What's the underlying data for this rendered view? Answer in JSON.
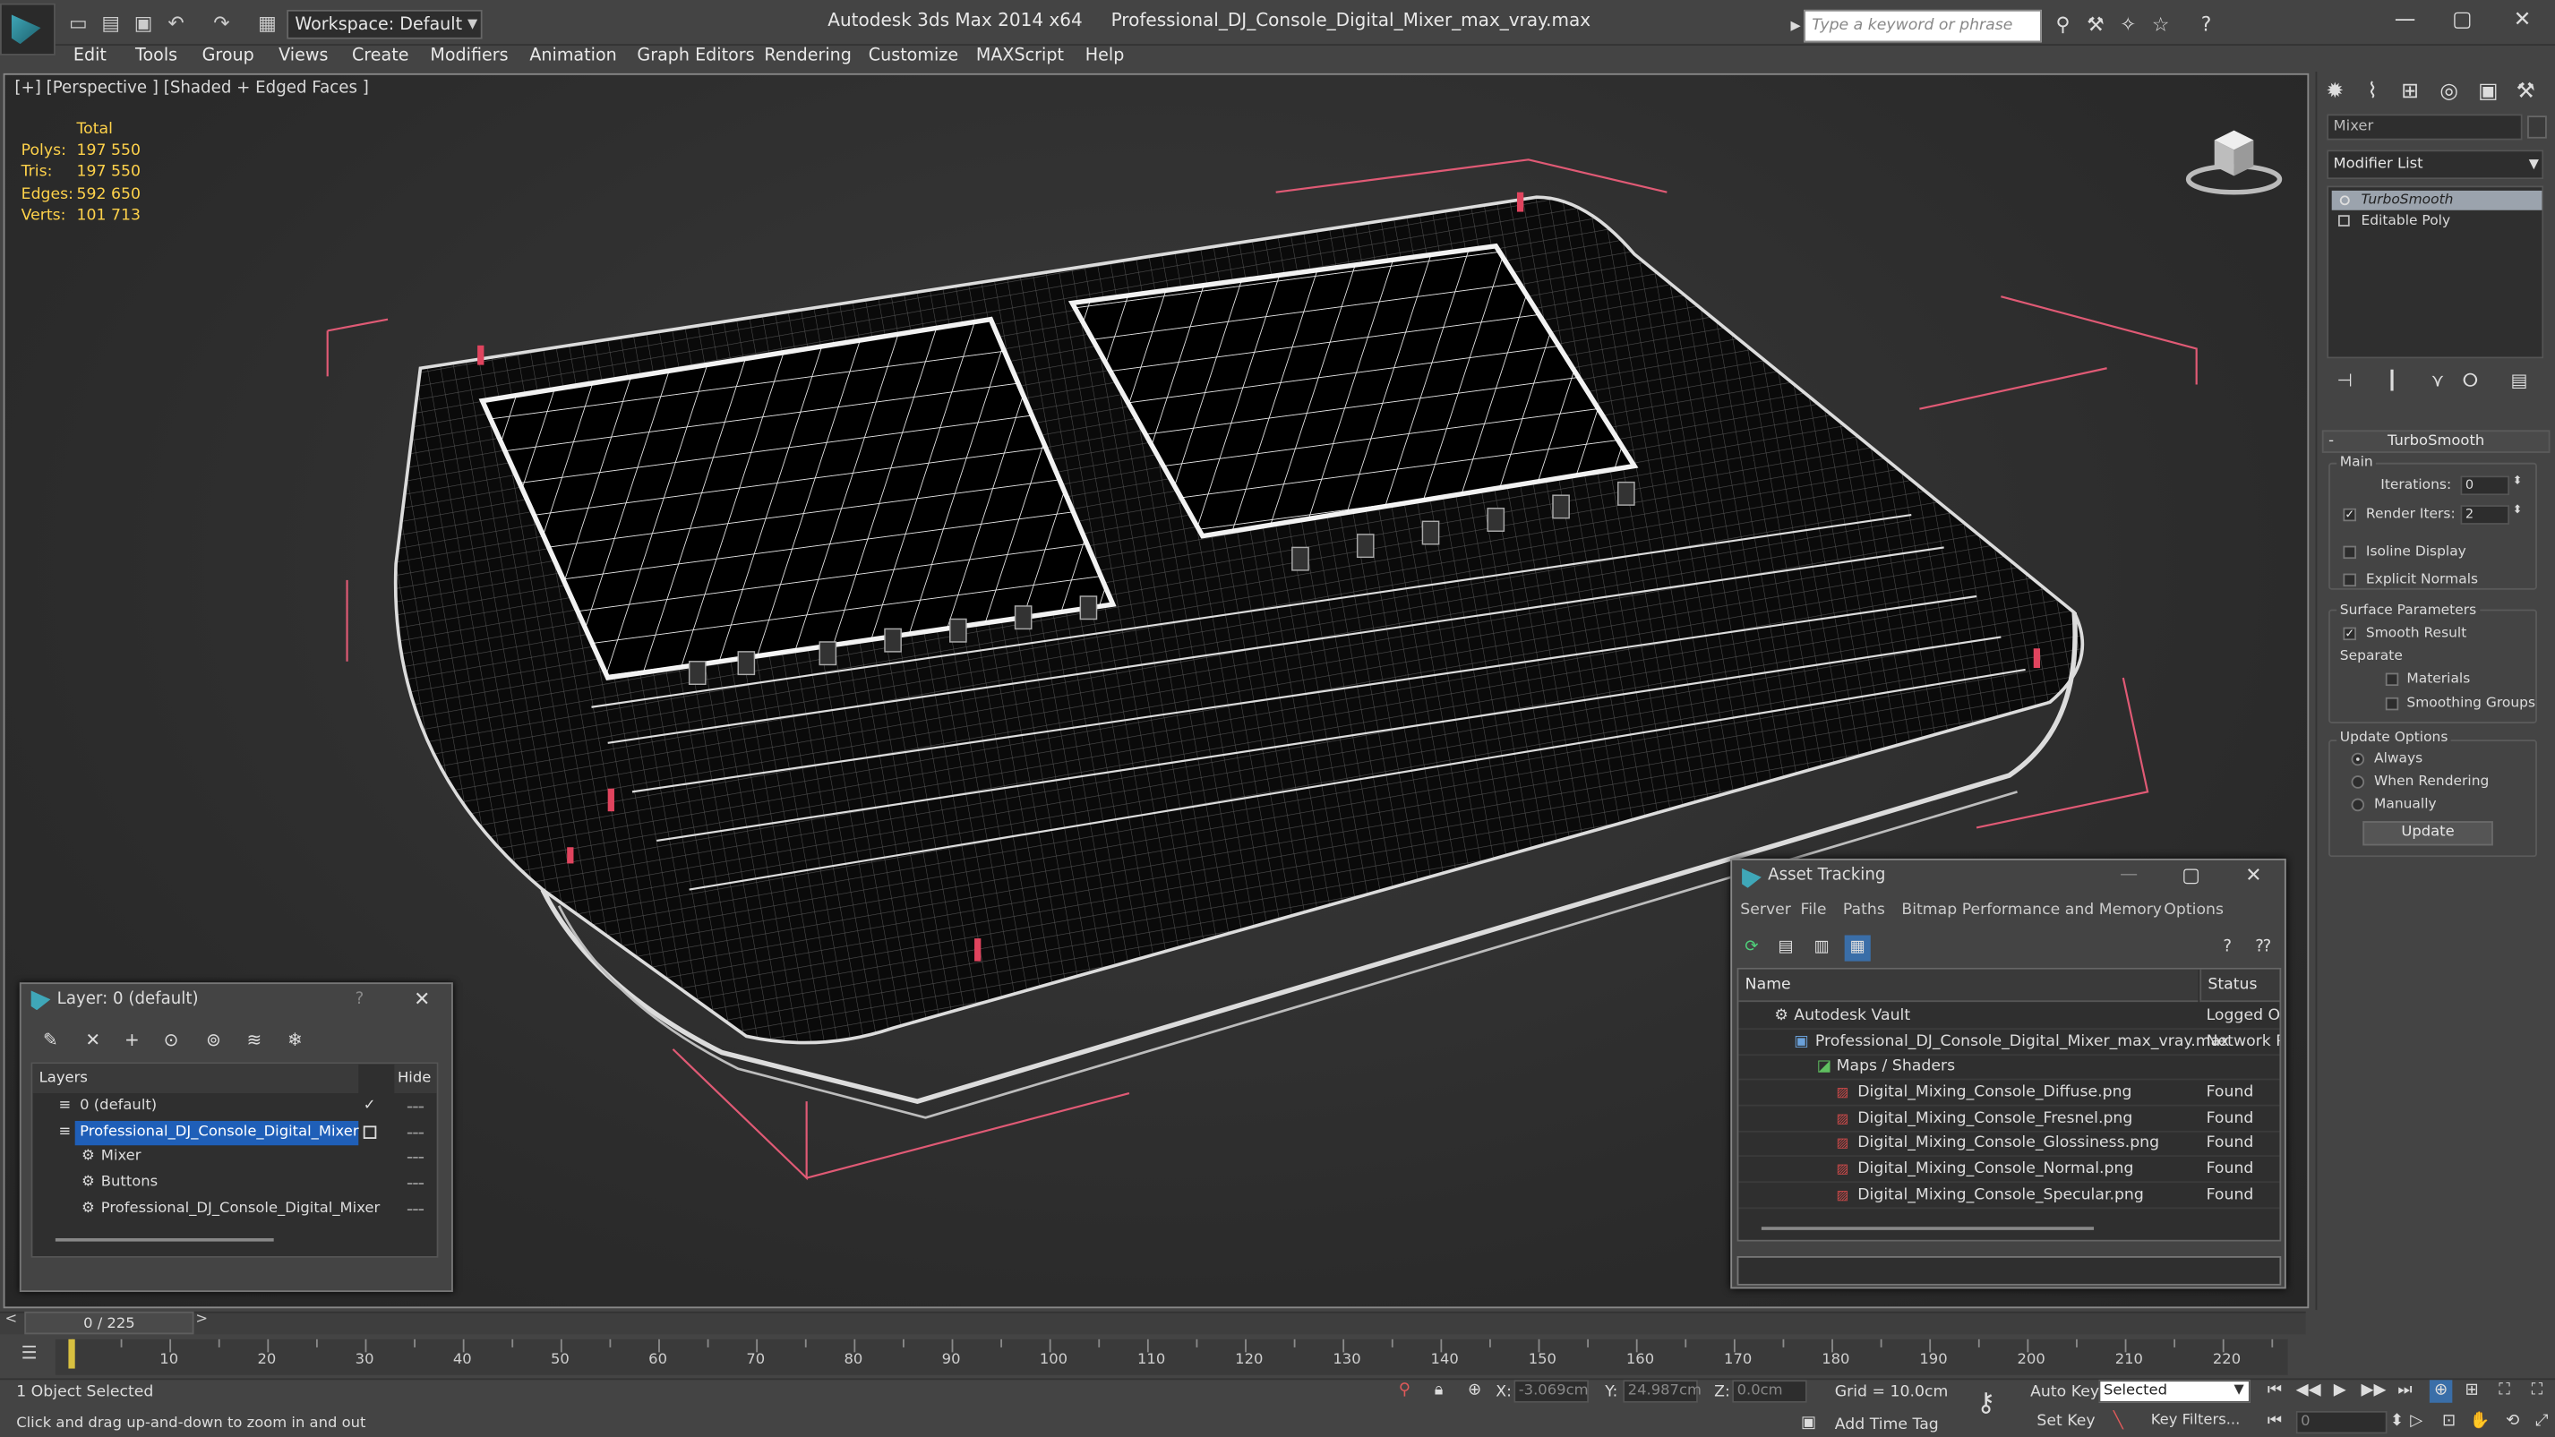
{
  "titlebar": {
    "workspace": "Workspace: Default",
    "app_name": "Autodesk 3ds Max  2014 x64",
    "file_name": "Professional_DJ_Console_Digital_Mixer_max_vray.max",
    "search_placeholder": "Type a keyword or phrase"
  },
  "menu": [
    "Edit",
    "Tools",
    "Group",
    "Views",
    "Create",
    "Modifiers",
    "Animation",
    "Graph Editors",
    "Rendering",
    "Customize",
    "MAXScript",
    "Help"
  ],
  "viewport": {
    "label": "[+] [Perspective ] [Shaded + Edged Faces ]",
    "stats": {
      "header": "Total",
      "rows": [
        {
          "label": "Polys:",
          "value": "197 550"
        },
        {
          "label": "Tris:",
          "value": "197 550"
        },
        {
          "label": "Edges:",
          "value": "592 650"
        },
        {
          "label": "Verts:",
          "value": "101 713"
        }
      ]
    }
  },
  "command_panel": {
    "object_name": "Mixer",
    "modifier_list": "Modifier List",
    "stack": [
      {
        "label": "TurboSmooth",
        "selected": true
      },
      {
        "label": "Editable Poly",
        "selected": false
      }
    ],
    "rollout_title": "TurboSmooth",
    "main_label": "Main",
    "iterations_label": "Iterations:",
    "iterations_value": "0",
    "render_iters_label": "Render Iters:",
    "render_iters_value": "2",
    "isoline_label": "Isoline Display",
    "explicit_label": "Explicit Normals",
    "surface_label": "Surface Parameters",
    "smooth_label": "Smooth Result",
    "separate_label": "Separate",
    "materials_label": "Materials",
    "smoothing_groups_label": "Smoothing Groups",
    "update_options_label": "Update Options",
    "always_label": "Always",
    "when_rendering_label": "When Rendering",
    "manually_label": "Manually",
    "update_button": "Update"
  },
  "layer_window": {
    "title": "Layer: 0 (default)",
    "help": "?",
    "col_layers": "Layers",
    "col_hide": "Hide",
    "rows": [
      {
        "name": "0 (default)",
        "indent": 1,
        "selected": false
      },
      {
        "name": "Professional_DJ_Console_Digital_Mixer",
        "indent": 1,
        "selected": true
      },
      {
        "name": "Mixer",
        "indent": 2,
        "selected": false
      },
      {
        "name": "Buttons",
        "indent": 2,
        "selected": false
      },
      {
        "name": "Professional_DJ_Console_Digital_Mixer",
        "indent": 2,
        "selected": false
      }
    ]
  },
  "asset_window": {
    "title": "Asset Tracking",
    "menu": [
      "Server",
      "File",
      "Paths",
      "Bitmap Performance and Memory",
      "Options"
    ],
    "col_name": "Name",
    "col_status": "Status",
    "rows": [
      {
        "name": "Autodesk Vault",
        "status": "Logged Ou",
        "indent": 1
      },
      {
        "name": "Professional_DJ_Console_Digital_Mixer_max_vray.max",
        "status": "Network P",
        "indent": 2
      },
      {
        "name": "Maps / Shaders",
        "status": "",
        "indent": 3
      },
      {
        "name": "Digital_Mixing_Console_Diffuse.png",
        "status": "Found",
        "indent": 4
      },
      {
        "name": "Digital_Mixing_Console_Fresnel.png",
        "status": "Found",
        "indent": 4
      },
      {
        "name": "Digital_Mixing_Console_Glossiness.png",
        "status": "Found",
        "indent": 4
      },
      {
        "name": "Digital_Mixing_Console_Normal.png",
        "status": "Found",
        "indent": 4
      },
      {
        "name": "Digital_Mixing_Console_Specular.png",
        "status": "Found",
        "indent": 4
      }
    ]
  },
  "timeline": {
    "frame": "0 / 225",
    "labels": [
      "10",
      "20",
      "30",
      "40",
      "50",
      "60",
      "70",
      "80",
      "90",
      "100",
      "110",
      "120",
      "130",
      "140",
      "150",
      "160",
      "170",
      "180",
      "190",
      "200",
      "210",
      "220"
    ]
  },
  "statusbar": {
    "selection": "1 Object Selected",
    "prompt": "Click and drag up-and-down to zoom in and out",
    "x_label": "X:",
    "x_value": "-3.069cm",
    "y_label": "Y:",
    "y_value": "24.987cm",
    "z_label": "Z:",
    "z_value": "0.0cm",
    "grid": "Grid = 10.0cm",
    "add_time_tag": "Add Time Tag",
    "auto_key": "Auto Key",
    "set_key": "Set Key",
    "selected_dropdown": "Selected",
    "key_filters": "Key Filters...",
    "frame_field": "0"
  },
  "colors": {
    "stats_yellow": "#ffd24a",
    "selection_blue": "#1f5fb8",
    "bbox_red": "#e05a75"
  }
}
